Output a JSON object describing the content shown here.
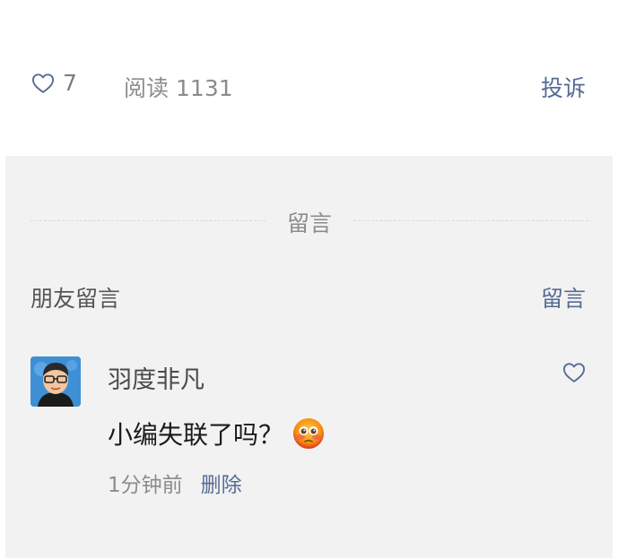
{
  "stats": {
    "like_count": "7",
    "read_label": "阅读",
    "read_count": "1131",
    "report_label": "投诉"
  },
  "comments_section": {
    "divider_title": "留言",
    "friends_header": "朋友留言",
    "write_label": "留言",
    "items": [
      {
        "author": "羽度非凡",
        "text": "小编失联了吗？",
        "time": "1分钟前",
        "delete_label": "删除",
        "emoji": "flushed-face-emoji"
      }
    ]
  },
  "colors": {
    "link": "#576b95",
    "panel_bg": "#f2f2f2",
    "muted_text": "#8c8c8c"
  }
}
